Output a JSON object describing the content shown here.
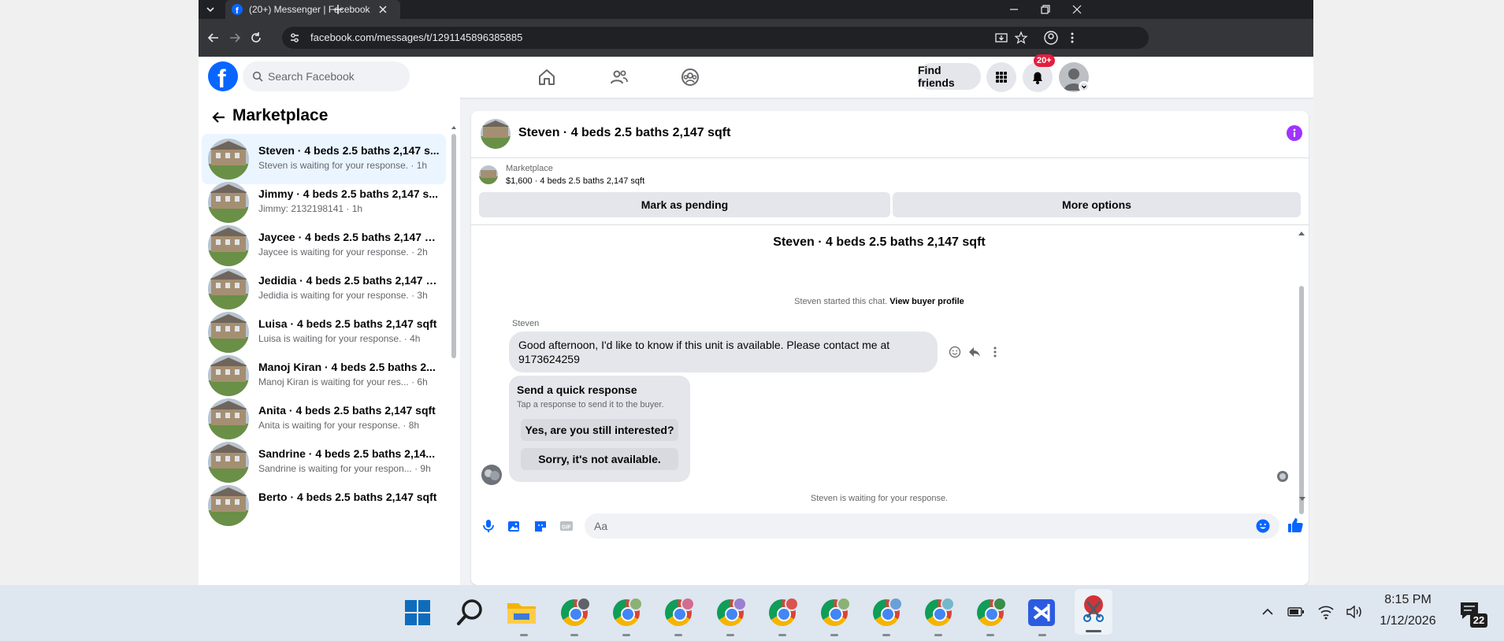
{
  "browser": {
    "tab_title": "(20+) Messenger | Facebook",
    "url": "facebook.com/messages/t/1291145896385885"
  },
  "fb_header": {
    "search_placeholder": "Search Facebook",
    "find_friends": "Find friends",
    "notification_badge": "20+"
  },
  "sidebar": {
    "title": "Marketplace",
    "conversations": [
      {
        "name": "Steven · 4 beds 2.5 baths 2,147 s...",
        "sub": "Steven is waiting for your response. · 1h"
      },
      {
        "name": "Jimmy · 4 beds 2.5 baths 2,147 s...",
        "sub": "Jimmy: 2132198141 · 1h"
      },
      {
        "name": "Jaycee · 4 beds 2.5 baths 2,147 s...",
        "sub": "Jaycee is waiting for your response. · 2h"
      },
      {
        "name": "Jedidia · 4 beds 2.5 baths 2,147 s...",
        "sub": "Jedidia is waiting for your response. · 3h"
      },
      {
        "name": "Luisa · 4 beds 2.5 baths 2,147 sqft",
        "sub": "Luisa is waiting for your response. · 4h"
      },
      {
        "name": "Manoj Kiran · 4 beds 2.5 baths 2...",
        "sub": "Manoj Kiran is waiting for your res... · 6h"
      },
      {
        "name": "Anita · 4 beds 2.5 baths 2,147 sqft",
        "sub": "Anita is waiting for your response. · 8h"
      },
      {
        "name": "Sandrine · 4 beds 2.5 baths 2,14...",
        "sub": "Sandrine is waiting for your respon... · 9h"
      },
      {
        "name": "Berto · 4 beds 2.5 baths 2,147 sqft",
        "sub": ""
      }
    ]
  },
  "chat": {
    "header_title": "Steven · 4 beds 2.5 baths 2,147 sqft",
    "listing_label": "Marketplace",
    "listing_detail": "$1,600 · 4 beds 2.5 baths 2,147 sqft",
    "mark_pending": "Mark as pending",
    "more_options": "More options",
    "thread_title": "Steven · 4 beds 2.5 baths 2,147 sqft",
    "started_text": "Steven started this chat.",
    "view_profile": "View buyer profile",
    "sender_name": "Steven",
    "message": "Good afternoon, I'd like to know if this unit is available. Please contact me at 9173624259",
    "quick_title": "Send a quick response",
    "quick_sub": "Tap a response to send it to the buyer.",
    "quick_1": "Yes, are you still interested?",
    "quick_2": "Sorry, it's not available.",
    "waiting_text": "Steven is waiting for your response.",
    "composer_placeholder": "Aa"
  },
  "taskbar": {
    "time": "8:15 PM",
    "date": "1/12/2026",
    "notification_count": "22"
  },
  "colors": {
    "fb_blue": "#0866ff",
    "badge_red": "#e41e3f",
    "info_purple": "#a033ff"
  }
}
